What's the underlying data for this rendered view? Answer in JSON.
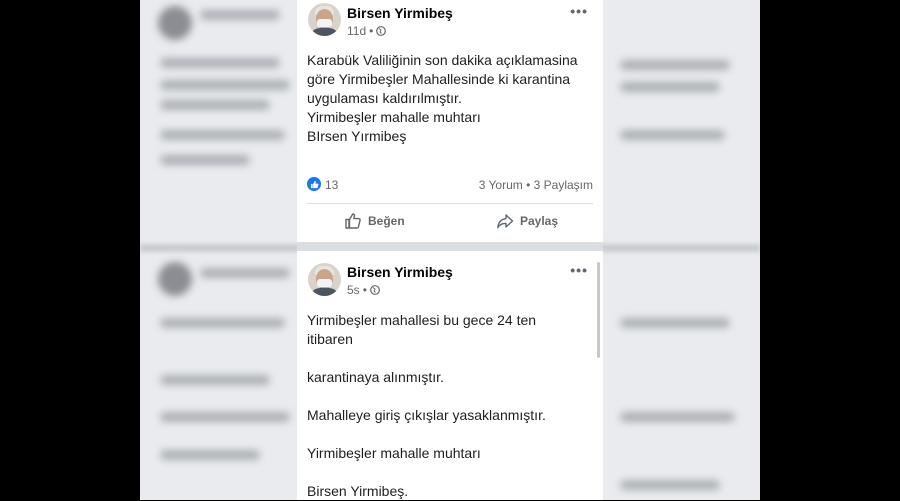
{
  "posts": [
    {
      "author": "Birsen Yirmibeş",
      "time": "11d",
      "separator": "•",
      "more": "•••",
      "lines": [
        "Karabük Valiliğinin son dakika açıklamasina göre Yirmibeşler Mahallesinde ki karantina uygulaması kaldırılmıştır.",
        "Yirmibeşler mahalle muhtarı",
        "BIrsen Yırmibeş"
      ],
      "like_count": "13",
      "comments": "3 Yorum",
      "shares": "3 Paylaşım",
      "actions": {
        "like": "Beğen",
        "share": "Paylaş"
      }
    },
    {
      "author": "Birsen Yirmibeş",
      "time": "5s",
      "separator": "•",
      "more": "•••",
      "lines": [
        "Yirmibeşler mahallesi bu gece 24 ten itibaren",
        "karantinaya alınmıştır.",
        "Mahalleye giriş çıkışlar yasaklanmıştır.",
        "Yirmibeşler mahalle muhtarı",
        "Birsen Yirmibeş."
      ]
    }
  ],
  "colors": {
    "accent": "#1877f2",
    "text": "#1c1e21",
    "secondary": "#65676b"
  },
  "icons": {
    "like": "thumbs-up-icon",
    "share": "share-arrow-icon",
    "privacy": "globe-icon",
    "menu": "more-options-icon"
  }
}
